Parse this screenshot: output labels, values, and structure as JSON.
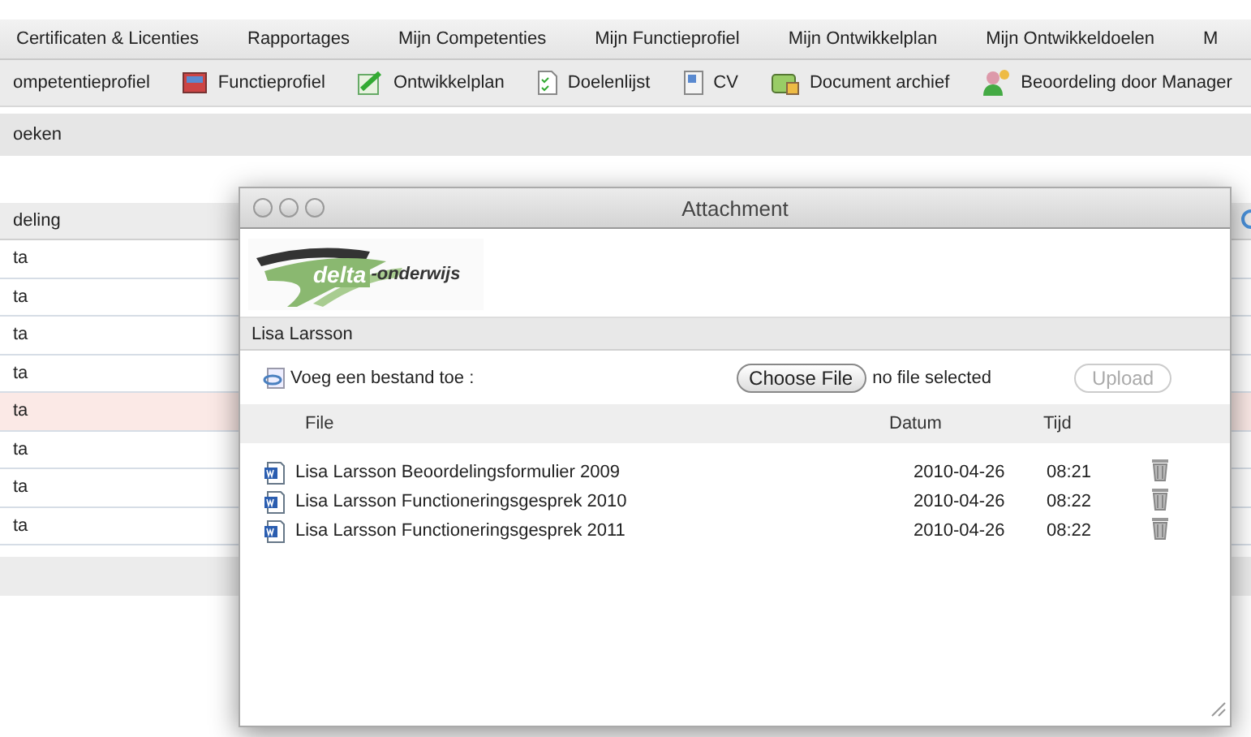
{
  "nav_tabs": [
    "Certificaten & Licenties",
    "Rapportages",
    "Mijn Competenties",
    "Mijn Functieprofiel",
    "Mijn Ontwikkelplan",
    "Mijn Ontwikkeldoelen",
    "M"
  ],
  "toolbar": [
    {
      "label": "ompetentieprofiel"
    },
    {
      "label": "Functieprofiel"
    },
    {
      "label": "Ontwikkelplan"
    },
    {
      "label": "Doelenlijst"
    },
    {
      "label": "CV"
    },
    {
      "label": "Document archief"
    },
    {
      "label": "Beoordeling door Manager"
    }
  ],
  "subbar": {
    "label": "oeken"
  },
  "table": {
    "column_1": "deling",
    "rows": [
      {
        "cell": "ta",
        "selected": false
      },
      {
        "cell": "ta",
        "selected": false
      },
      {
        "cell": "ta",
        "selected": false
      },
      {
        "cell": "ta",
        "selected": false
      },
      {
        "cell": "ta",
        "selected": true
      },
      {
        "cell": "ta",
        "selected": false
      },
      {
        "cell": "ta",
        "selected": false
      },
      {
        "cell": "ta",
        "selected": false
      }
    ]
  },
  "dialog": {
    "title": "Attachment",
    "logo_word": "delta",
    "logo_suffix": "-onderwijs",
    "person": "Lisa Larsson",
    "add_label": "Voeg een bestand toe :",
    "choose_button": "Choose File",
    "file_status": "no file selected",
    "upload_button": {
      "label": "Upload",
      "disabled": true
    },
    "columns": [
      "File",
      "Datum",
      "Tijd"
    ],
    "files": [
      {
        "name": "Lisa Larsson Beoordelingsformulier 2009",
        "date": "2010-04-26",
        "time": "08:21"
      },
      {
        "name": "Lisa Larsson Functioneringsgesprek 2010",
        "date": "2010-04-26",
        "time": "08:22"
      },
      {
        "name": "Lisa Larsson Functioneringsgesprek 2011",
        "date": "2010-04-26",
        "time": "08:22"
      }
    ]
  }
}
